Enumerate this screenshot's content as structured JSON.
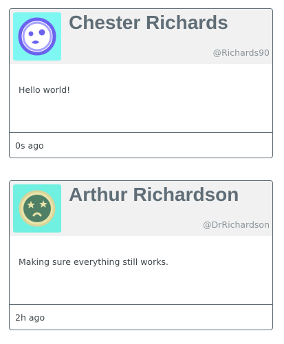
{
  "posts": [
    {
      "author": {
        "name": "Chester Richards",
        "handle": "@Richards90",
        "avatar_icon": "shocked-face-icon",
        "avatar_bg": "#7ef7f3"
      },
      "message": "Hello world!",
      "time_ago": "0s ago"
    },
    {
      "author": {
        "name": "Arthur Richardson",
        "handle": "@DrRichardson",
        "avatar_icon": "star-eyed-face-icon",
        "avatar_bg": "#6ff0e0"
      },
      "message": "Making sure everything still works.",
      "time_ago": "2h ago"
    }
  ]
}
